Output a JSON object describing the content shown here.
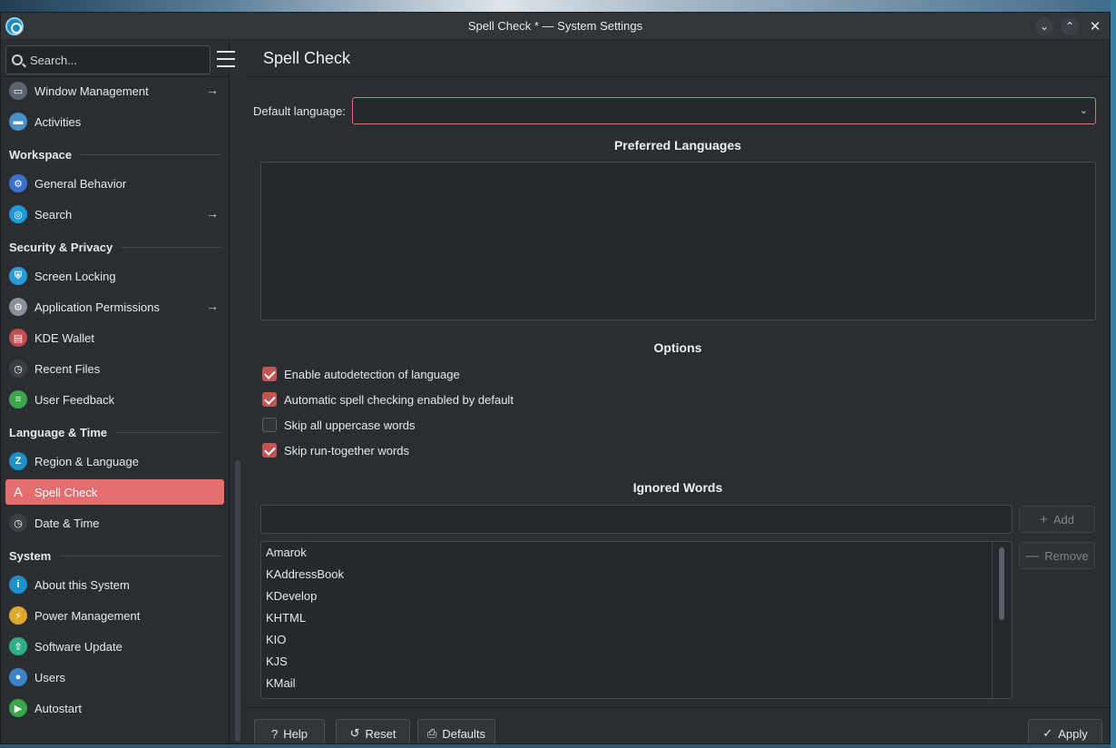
{
  "window": {
    "title": "Spell Check * — System Settings",
    "controls": {
      "minimize": "⌄",
      "maximize": "⌃",
      "close": "✕"
    }
  },
  "sidebar": {
    "search_placeholder": "Search...",
    "items": [
      {
        "type": "item",
        "label": "Window Management",
        "icon": "window-management-icon",
        "arrow": true
      },
      {
        "type": "item",
        "label": "Activities",
        "icon": "activities-icon"
      },
      {
        "type": "header",
        "label": "Workspace"
      },
      {
        "type": "item",
        "label": "General Behavior",
        "icon": "general-behavior-icon"
      },
      {
        "type": "item",
        "label": "Search",
        "icon": "search-icon",
        "arrow": true
      },
      {
        "type": "header",
        "label": "Security & Privacy"
      },
      {
        "type": "item",
        "label": "Screen Locking",
        "icon": "screen-locking-icon"
      },
      {
        "type": "item",
        "label": "Application Permissions",
        "icon": "application-permissions-icon",
        "arrow": true
      },
      {
        "type": "item",
        "label": "KDE Wallet",
        "icon": "kde-wallet-icon"
      },
      {
        "type": "item",
        "label": "Recent Files",
        "icon": "recent-files-icon"
      },
      {
        "type": "item",
        "label": "User Feedback",
        "icon": "user-feedback-icon"
      },
      {
        "type": "header",
        "label": "Language & Time"
      },
      {
        "type": "item",
        "label": "Region & Language",
        "icon": "region-language-icon"
      },
      {
        "type": "item",
        "label": "Spell Check",
        "icon": "spell-check-icon",
        "active": true
      },
      {
        "type": "item",
        "label": "Date & Time",
        "icon": "date-time-icon"
      },
      {
        "type": "header",
        "label": "System"
      },
      {
        "type": "item",
        "label": "About this System",
        "icon": "about-system-icon"
      },
      {
        "type": "item",
        "label": "Power Management",
        "icon": "power-management-icon"
      },
      {
        "type": "item",
        "label": "Software Update",
        "icon": "software-update-icon"
      },
      {
        "type": "item",
        "label": "Users",
        "icon": "users-icon"
      },
      {
        "type": "item",
        "label": "Autostart",
        "icon": "autostart-icon"
      }
    ]
  },
  "page": {
    "title": "Spell Check",
    "default_language_label": "Default language:",
    "default_language_value": "",
    "preferred_languages_title": "Preferred Languages",
    "options_title": "Options",
    "options": [
      {
        "label": "Enable autodetection of language",
        "checked": true
      },
      {
        "label": "Automatic spell checking enabled by default",
        "checked": true
      },
      {
        "label": "Skip all uppercase words",
        "checked": false
      },
      {
        "label": "Skip run-together words",
        "checked": true
      }
    ],
    "ignored_words_title": "Ignored Words",
    "ignored_word_input": "",
    "add_label": "Add",
    "remove_label": "Remove",
    "ignored_words": [
      "Amarok",
      "KAddressBook",
      "KDevelop",
      "KHTML",
      "KIO",
      "KJS",
      "KMail"
    ]
  },
  "footer": {
    "help_label": "Help",
    "reset_label": "Reset",
    "defaults_label": "Defaults",
    "apply_label": "Apply"
  },
  "colors": {
    "accent": "#e66d6d",
    "checkbox_on": "#c65353",
    "background": "#2a2e32"
  }
}
